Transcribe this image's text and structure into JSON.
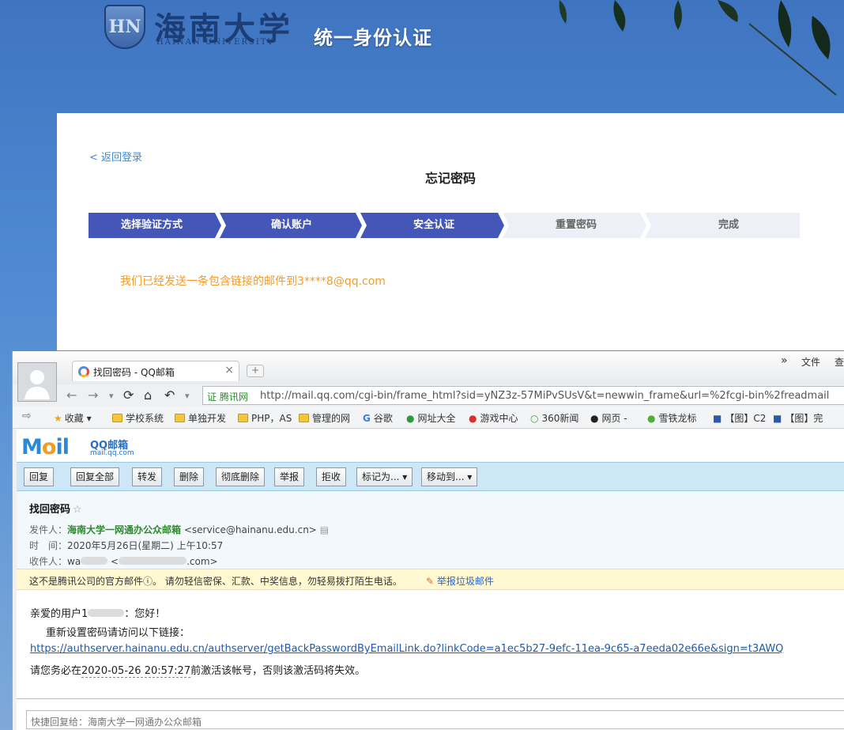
{
  "banner": {
    "seal_letters": "HN",
    "univ_name": "海南大学",
    "univ_name_en": "HAINAN UNIVERSITY",
    "system_title": "统一身份认证"
  },
  "page": {
    "back_link": "< 返回登录",
    "title": "忘记密码",
    "steps": [
      {
        "label": "选择验证方式",
        "state": "done"
      },
      {
        "label": "确认账户",
        "state": "done"
      },
      {
        "label": "安全认证",
        "state": "done"
      },
      {
        "label": "重置密码",
        "state": "todo"
      },
      {
        "label": "完成",
        "state": "todo"
      }
    ],
    "sent_message": "我们已经发送一条包含链接的邮件到3****8@qq.com"
  },
  "browser": {
    "tab_title": "找回密码 - QQ邮箱",
    "tab_close": "×",
    "new_tab": "+",
    "menu_more": "»",
    "menu_file": "文件",
    "menu_view": "查",
    "url_cert": "证 腾讯网",
    "url": "http://mail.qq.com/cgi-bin/frame_html?sid=yNZ3z-57MiPvSUsV&t=newwin_frame&url=%2fcgi-bin%2freadmail",
    "bookmarks": [
      {
        "label": "收藏",
        "icon": "star-icon"
      },
      {
        "label": "学校系统",
        "icon": "folder-icon"
      },
      {
        "label": "单独开发",
        "icon": "folder-icon"
      },
      {
        "label": "PHP，AS",
        "icon": "folder-icon"
      },
      {
        "label": "管理的网",
        "icon": "folder-icon"
      },
      {
        "label": "谷歌",
        "icon": "google-icon"
      },
      {
        "label": "网址大全",
        "icon": "site-icon"
      },
      {
        "label": "游戏中心",
        "icon": "game-icon"
      },
      {
        "label": "360新闻",
        "icon": "news-icon"
      },
      {
        "label": "网页 -",
        "icon": "web-icon"
      },
      {
        "label": "雪铁龙标",
        "icon": "car-icon"
      },
      {
        "label": "【图】C2",
        "icon": "image-icon"
      },
      {
        "label": "【图】完",
        "icon": "image-icon"
      }
    ]
  },
  "mail": {
    "logo_text": "Mail",
    "logo_name": "QQ邮箱",
    "logo_domain": "mail.qq.com",
    "toolbar": [
      "回复",
      "回复全部",
      "转发",
      "删除",
      "彻底删除",
      "举报",
      "拒收",
      "标记为... ▾",
      "移动到... ▾"
    ],
    "subject": "找回密码",
    "star": "☆",
    "from_label": "发件人：",
    "from_name": "海南大学一网通办公众邮箱",
    "from_addr": "<service@hainanu.edu.cn>",
    "time_label": "时　间：",
    "time_value": "2020年5月26日(星期二) 上午10:57",
    "to_label": "收件人：",
    "to_name_start": "wa",
    "to_addr_start": "<",
    "to_addr_end": ".com>",
    "warning": "这不是腾讯公司的官方邮件ⓘ。  请勿轻信密保、汇款、中奖信息，勿轻易拨打陌生电话。",
    "report": "举报垃圾邮件",
    "greeting_start": "亲爱的用户1",
    "greeting_end": "：您好！",
    "instruction": "重新设置密码请访问以下链接：",
    "link": "https://authserver.hainanu.edu.cn/authserver/getBackPasswordByEmailLink.do?linkCode=a1ec5b27-9efc-11ea-9c65-a7eeda02e66e&sign=t3AWQ",
    "expire_before": "请您务必在",
    "expire_time": "2020-05-26 20:57:27",
    "expire_after": "前激活该帐号，否则该激活码将失效。",
    "reply_placeholder": "快捷回复给：海南大学一网通办公众邮箱"
  }
}
